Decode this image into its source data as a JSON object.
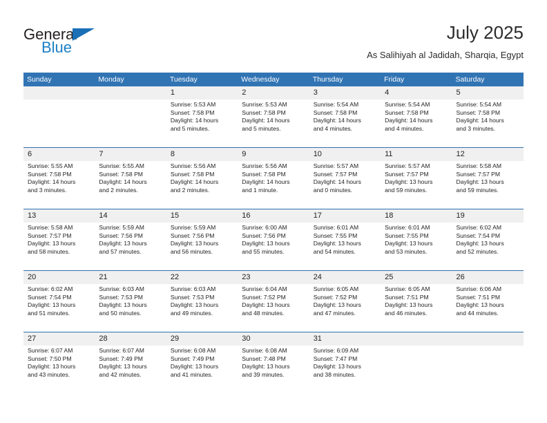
{
  "brand": {
    "name_part1": "General",
    "name_part2": "Blue",
    "accent_color": "#1a6fb5"
  },
  "header": {
    "title": "July 2025",
    "location": "As Salihiyah al Jadidah, Sharqia, Egypt"
  },
  "theme": {
    "header_blue": "#3174b4",
    "row_divider_blue": "#2f6fae",
    "daynum_band": "#f0f0f0"
  },
  "weekdays": [
    "Sunday",
    "Monday",
    "Tuesday",
    "Wednesday",
    "Thursday",
    "Friday",
    "Saturday"
  ],
  "labels": {
    "sunrise_prefix": "Sunrise:",
    "sunset_prefix": "Sunset:",
    "daylight_prefix": "Daylight:"
  },
  "weeks": [
    [
      {
        "day": "",
        "sunrise": "",
        "sunset": "",
        "daylight_line1": "",
        "daylight_line2": ""
      },
      {
        "day": "",
        "sunrise": "",
        "sunset": "",
        "daylight_line1": "",
        "daylight_line2": ""
      },
      {
        "day": "1",
        "sunrise": "Sunrise: 5:53 AM",
        "sunset": "Sunset: 7:58 PM",
        "daylight_line1": "Daylight: 14 hours",
        "daylight_line2": "and 5 minutes."
      },
      {
        "day": "2",
        "sunrise": "Sunrise: 5:53 AM",
        "sunset": "Sunset: 7:58 PM",
        "daylight_line1": "Daylight: 14 hours",
        "daylight_line2": "and 5 minutes."
      },
      {
        "day": "3",
        "sunrise": "Sunrise: 5:54 AM",
        "sunset": "Sunset: 7:58 PM",
        "daylight_line1": "Daylight: 14 hours",
        "daylight_line2": "and 4 minutes."
      },
      {
        "day": "4",
        "sunrise": "Sunrise: 5:54 AM",
        "sunset": "Sunset: 7:58 PM",
        "daylight_line1": "Daylight: 14 hours",
        "daylight_line2": "and 4 minutes."
      },
      {
        "day": "5",
        "sunrise": "Sunrise: 5:54 AM",
        "sunset": "Sunset: 7:58 PM",
        "daylight_line1": "Daylight: 14 hours",
        "daylight_line2": "and 3 minutes."
      }
    ],
    [
      {
        "day": "6",
        "sunrise": "Sunrise: 5:55 AM",
        "sunset": "Sunset: 7:58 PM",
        "daylight_line1": "Daylight: 14 hours",
        "daylight_line2": "and 3 minutes."
      },
      {
        "day": "7",
        "sunrise": "Sunrise: 5:55 AM",
        "sunset": "Sunset: 7:58 PM",
        "daylight_line1": "Daylight: 14 hours",
        "daylight_line2": "and 2 minutes."
      },
      {
        "day": "8",
        "sunrise": "Sunrise: 5:56 AM",
        "sunset": "Sunset: 7:58 PM",
        "daylight_line1": "Daylight: 14 hours",
        "daylight_line2": "and 2 minutes."
      },
      {
        "day": "9",
        "sunrise": "Sunrise: 5:56 AM",
        "sunset": "Sunset: 7:58 PM",
        "daylight_line1": "Daylight: 14 hours",
        "daylight_line2": "and 1 minute."
      },
      {
        "day": "10",
        "sunrise": "Sunrise: 5:57 AM",
        "sunset": "Sunset: 7:57 PM",
        "daylight_line1": "Daylight: 14 hours",
        "daylight_line2": "and 0 minutes."
      },
      {
        "day": "11",
        "sunrise": "Sunrise: 5:57 AM",
        "sunset": "Sunset: 7:57 PM",
        "daylight_line1": "Daylight: 13 hours",
        "daylight_line2": "and 59 minutes."
      },
      {
        "day": "12",
        "sunrise": "Sunrise: 5:58 AM",
        "sunset": "Sunset: 7:57 PM",
        "daylight_line1": "Daylight: 13 hours",
        "daylight_line2": "and 59 minutes."
      }
    ],
    [
      {
        "day": "13",
        "sunrise": "Sunrise: 5:58 AM",
        "sunset": "Sunset: 7:57 PM",
        "daylight_line1": "Daylight: 13 hours",
        "daylight_line2": "and 58 minutes."
      },
      {
        "day": "14",
        "sunrise": "Sunrise: 5:59 AM",
        "sunset": "Sunset: 7:56 PM",
        "daylight_line1": "Daylight: 13 hours",
        "daylight_line2": "and 57 minutes."
      },
      {
        "day": "15",
        "sunrise": "Sunrise: 5:59 AM",
        "sunset": "Sunset: 7:56 PM",
        "daylight_line1": "Daylight: 13 hours",
        "daylight_line2": "and 56 minutes."
      },
      {
        "day": "16",
        "sunrise": "Sunrise: 6:00 AM",
        "sunset": "Sunset: 7:56 PM",
        "daylight_line1": "Daylight: 13 hours",
        "daylight_line2": "and 55 minutes."
      },
      {
        "day": "17",
        "sunrise": "Sunrise: 6:01 AM",
        "sunset": "Sunset: 7:55 PM",
        "daylight_line1": "Daylight: 13 hours",
        "daylight_line2": "and 54 minutes."
      },
      {
        "day": "18",
        "sunrise": "Sunrise: 6:01 AM",
        "sunset": "Sunset: 7:55 PM",
        "daylight_line1": "Daylight: 13 hours",
        "daylight_line2": "and 53 minutes."
      },
      {
        "day": "19",
        "sunrise": "Sunrise: 6:02 AM",
        "sunset": "Sunset: 7:54 PM",
        "daylight_line1": "Daylight: 13 hours",
        "daylight_line2": "and 52 minutes."
      }
    ],
    [
      {
        "day": "20",
        "sunrise": "Sunrise: 6:02 AM",
        "sunset": "Sunset: 7:54 PM",
        "daylight_line1": "Daylight: 13 hours",
        "daylight_line2": "and 51 minutes."
      },
      {
        "day": "21",
        "sunrise": "Sunrise: 6:03 AM",
        "sunset": "Sunset: 7:53 PM",
        "daylight_line1": "Daylight: 13 hours",
        "daylight_line2": "and 50 minutes."
      },
      {
        "day": "22",
        "sunrise": "Sunrise: 6:03 AM",
        "sunset": "Sunset: 7:53 PM",
        "daylight_line1": "Daylight: 13 hours",
        "daylight_line2": "and 49 minutes."
      },
      {
        "day": "23",
        "sunrise": "Sunrise: 6:04 AM",
        "sunset": "Sunset: 7:52 PM",
        "daylight_line1": "Daylight: 13 hours",
        "daylight_line2": "and 48 minutes."
      },
      {
        "day": "24",
        "sunrise": "Sunrise: 6:05 AM",
        "sunset": "Sunset: 7:52 PM",
        "daylight_line1": "Daylight: 13 hours",
        "daylight_line2": "and 47 minutes."
      },
      {
        "day": "25",
        "sunrise": "Sunrise: 6:05 AM",
        "sunset": "Sunset: 7:51 PM",
        "daylight_line1": "Daylight: 13 hours",
        "daylight_line2": "and 46 minutes."
      },
      {
        "day": "26",
        "sunrise": "Sunrise: 6:06 AM",
        "sunset": "Sunset: 7:51 PM",
        "daylight_line1": "Daylight: 13 hours",
        "daylight_line2": "and 44 minutes."
      }
    ],
    [
      {
        "day": "27",
        "sunrise": "Sunrise: 6:07 AM",
        "sunset": "Sunset: 7:50 PM",
        "daylight_line1": "Daylight: 13 hours",
        "daylight_line2": "and 43 minutes."
      },
      {
        "day": "28",
        "sunrise": "Sunrise: 6:07 AM",
        "sunset": "Sunset: 7:49 PM",
        "daylight_line1": "Daylight: 13 hours",
        "daylight_line2": "and 42 minutes."
      },
      {
        "day": "29",
        "sunrise": "Sunrise: 6:08 AM",
        "sunset": "Sunset: 7:49 PM",
        "daylight_line1": "Daylight: 13 hours",
        "daylight_line2": "and 41 minutes."
      },
      {
        "day": "30",
        "sunrise": "Sunrise: 6:08 AM",
        "sunset": "Sunset: 7:48 PM",
        "daylight_line1": "Daylight: 13 hours",
        "daylight_line2": "and 39 minutes."
      },
      {
        "day": "31",
        "sunrise": "Sunrise: 6:09 AM",
        "sunset": "Sunset: 7:47 PM",
        "daylight_line1": "Daylight: 13 hours",
        "daylight_line2": "and 38 minutes."
      },
      {
        "day": "",
        "sunrise": "",
        "sunset": "",
        "daylight_line1": "",
        "daylight_line2": ""
      },
      {
        "day": "",
        "sunrise": "",
        "sunset": "",
        "daylight_line1": "",
        "daylight_line2": ""
      }
    ]
  ]
}
